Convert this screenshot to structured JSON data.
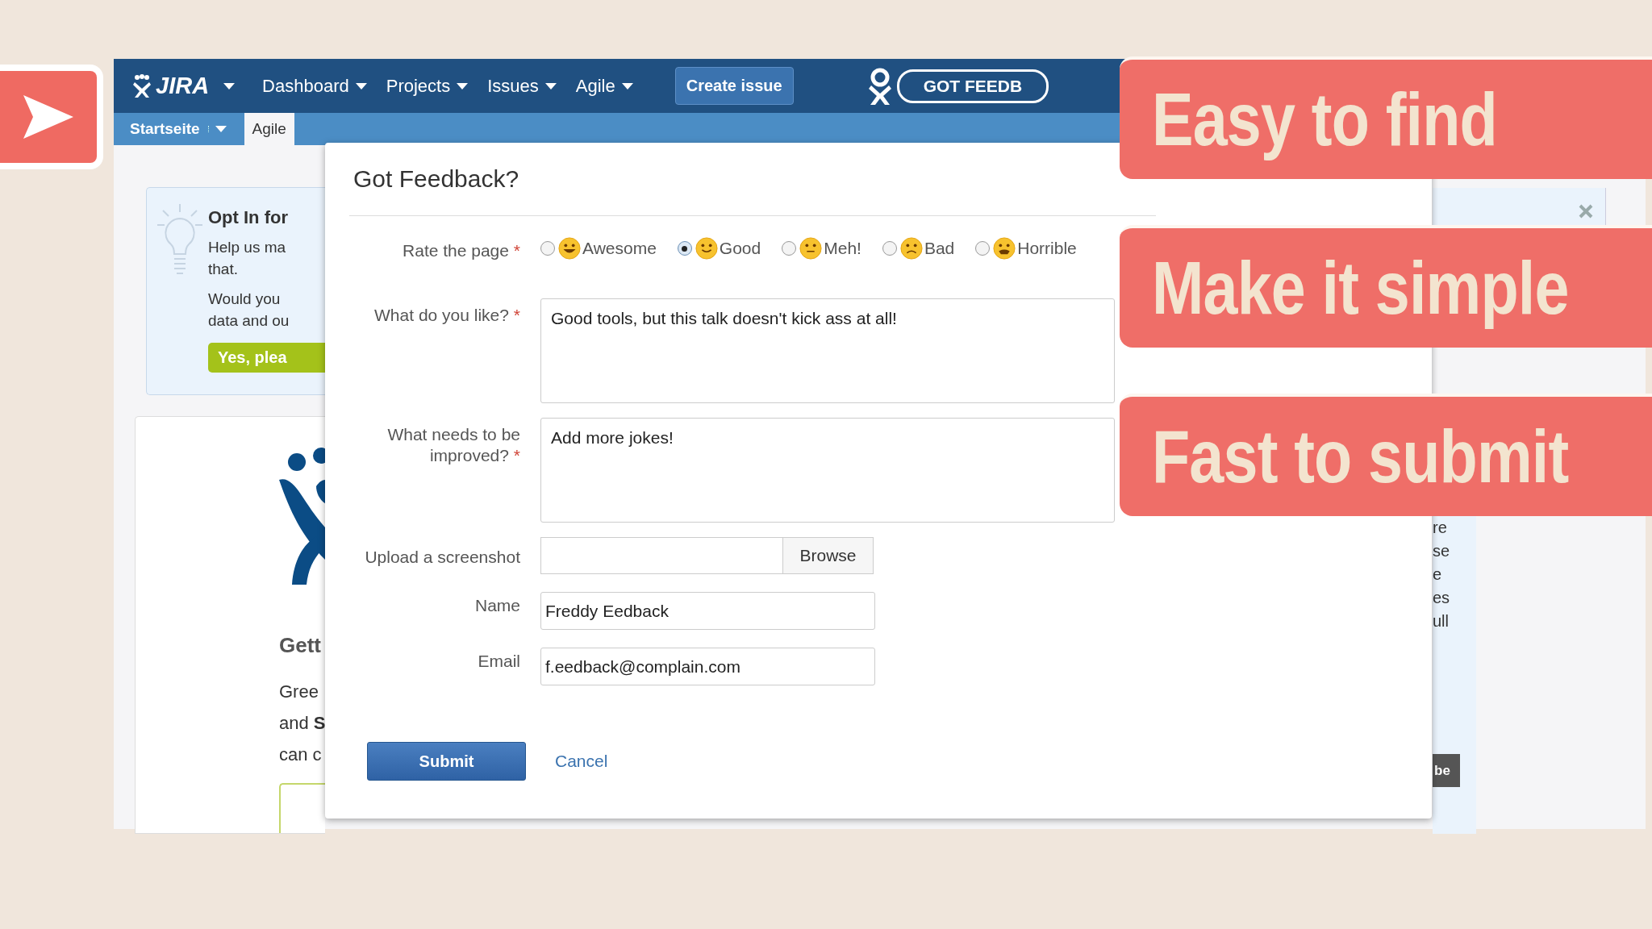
{
  "header": {
    "logo": "JIRA",
    "menus": [
      {
        "label": "Dashboard"
      },
      {
        "label": "Projects"
      },
      {
        "label": "Issues"
      },
      {
        "label": "Agile"
      }
    ],
    "create_button": "Create issue",
    "feedback_button": "GOT FEEDB"
  },
  "subnav": {
    "tabs": [
      {
        "label": "Startseite",
        "selected": false,
        "dropdown": true
      },
      {
        "label": "Agile",
        "selected": true,
        "dropdown": false
      }
    ]
  },
  "background": {
    "opt_in": {
      "title": "Opt In for",
      "paragraphs": [
        [
          "Help us ma",
          "that."
        ],
        [
          "Would you",
          "data and ou"
        ]
      ],
      "button": "Yes, plea"
    },
    "getting_started": {
      "title": "Gett",
      "lines": [
        "Gree",
        "and **S**",
        "can c"
      ]
    },
    "side_fragments": [
      "re",
      "se",
      "e",
      "es",
      "ull"
    ],
    "thumbnail_text": "be"
  },
  "dialog": {
    "title": "Got Feedback?",
    "rating": {
      "label": "Rate the page",
      "required_mark": "*",
      "options": [
        {
          "label": "Awesome",
          "selected": false
        },
        {
          "label": "Good",
          "selected": true
        },
        {
          "label": "Meh!",
          "selected": false
        },
        {
          "label": "Bad",
          "selected": false
        },
        {
          "label": "Horrible",
          "selected": false
        }
      ]
    },
    "fields": [
      {
        "kind": "textarea",
        "label": "What do you like?",
        "required_mark": "*",
        "value": "Good tools, but this talk doesn't kick ass at all!"
      },
      {
        "kind": "textarea",
        "label": "What needs to be improved?",
        "required_mark": "*",
        "value": "Add more jokes!"
      },
      {
        "kind": "file",
        "label": "Upload a screenshot",
        "button": "Browse"
      },
      {
        "kind": "text",
        "label": "Name",
        "value": "Freddy Eedback"
      },
      {
        "kind": "text",
        "label": "Email",
        "value": "f.eedback@complain.com"
      }
    ],
    "submit": "Submit",
    "cancel": "Cancel"
  },
  "banners": [
    "Easy to find",
    "Make it simple",
    "Fast to submit"
  ]
}
